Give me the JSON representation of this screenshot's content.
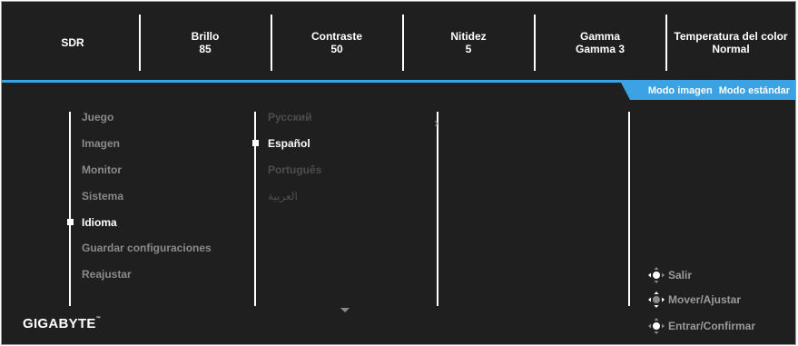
{
  "status_bar": [
    {
      "label": "SDR",
      "value": ""
    },
    {
      "label": "Brillo",
      "value": "85"
    },
    {
      "label": "Contraste",
      "value": "50"
    },
    {
      "label": "Nitidez",
      "value": "5"
    },
    {
      "label": "Gamma",
      "value": "Gamma 3"
    },
    {
      "label": "Temperatura del color",
      "value": "Normal"
    }
  ],
  "mode_bar": {
    "label": "Modo imagen",
    "value": "Modo estándar"
  },
  "colors": {
    "accent": "#3ba3e4",
    "background": "#201f20",
    "text": "#ffffff",
    "muted": "#8a8a8a"
  },
  "main_menu": [
    {
      "label": "Juego",
      "selected": false
    },
    {
      "label": "Imagen",
      "selected": false
    },
    {
      "label": "Monitor",
      "selected": false
    },
    {
      "label": "Sistema",
      "selected": false
    },
    {
      "label": "Idioma",
      "selected": true
    },
    {
      "label": "Guardar configuraciones",
      "selected": false
    },
    {
      "label": "Reajustar",
      "selected": false
    }
  ],
  "language_menu": [
    {
      "label": "Русский",
      "selected": false
    },
    {
      "label": "Español",
      "selected": true
    },
    {
      "label": "Português",
      "selected": false
    },
    {
      "label": "العربية",
      "selected": false
    }
  ],
  "brand": {
    "name": "GIGABYTE",
    "mark": "™"
  },
  "hints": [
    {
      "icon": "joystick-left-icon",
      "label": "Salir"
    },
    {
      "icon": "joystick-move-icon",
      "label": "Mover/Ajustar"
    },
    {
      "icon": "joystick-press-icon",
      "label": "Entrar/Confirmar"
    }
  ]
}
